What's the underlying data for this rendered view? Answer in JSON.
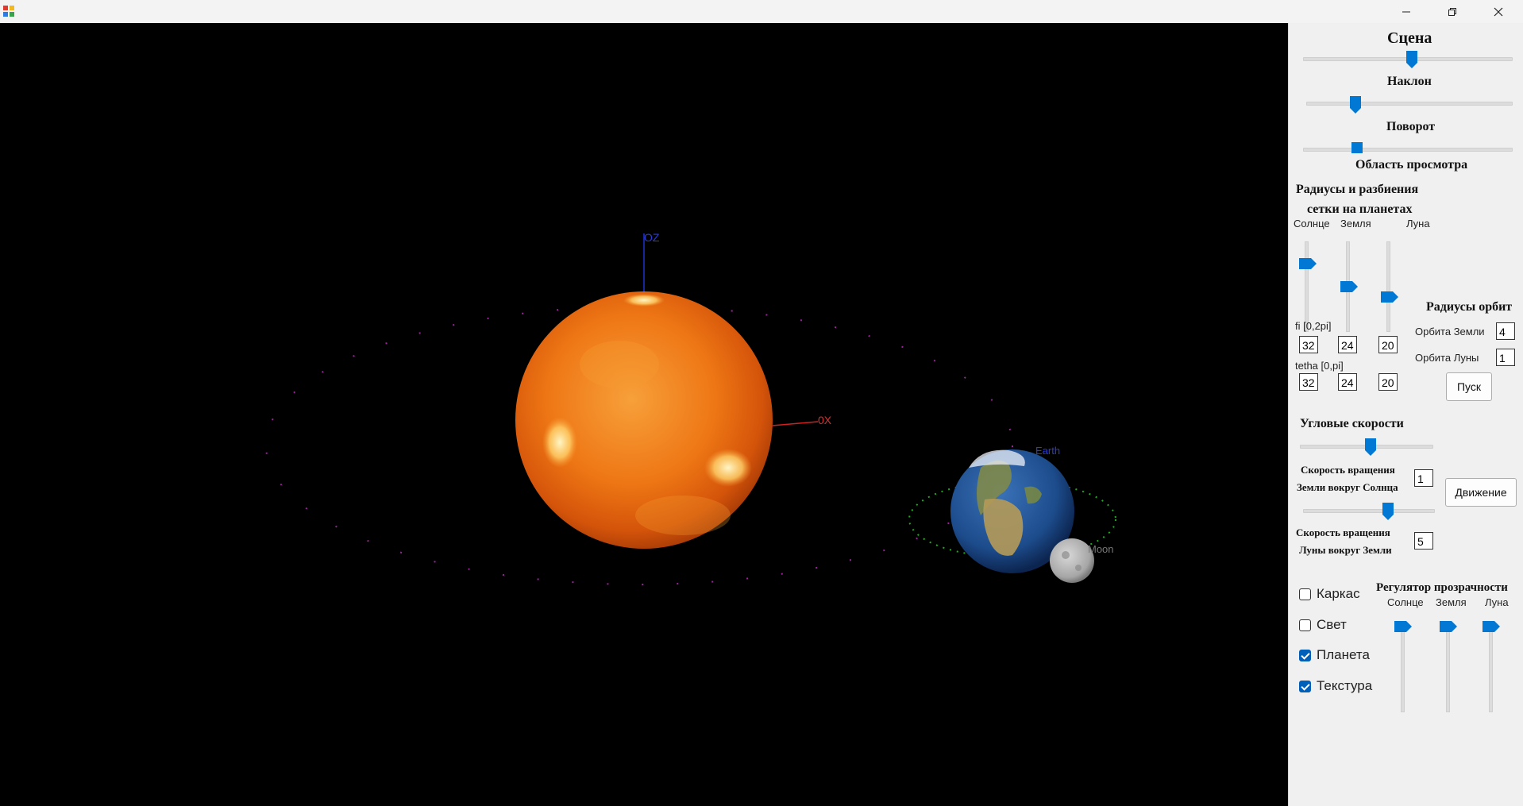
{
  "window": {
    "controls": [
      "minimize",
      "maximize",
      "close"
    ],
    "accent_color": "#0078d4"
  },
  "scene": {
    "axis_z_label": "OZ",
    "axis_x_label": "0X",
    "earth_label": "Earth",
    "moon_label": "Moon",
    "background": "#000000",
    "sun_color": "#f07a14",
    "orbit_earth_color": "#a020a0",
    "orbit_moon_color": "#22aa22"
  },
  "panel": {
    "scene_title": "Сцена",
    "tilt_title": "Наклон",
    "rotation_title": "Поворот",
    "view_area_title": "Область просмотра",
    "radius_title_line1": "Радиусы и разбиения",
    "radius_title_line2": "сетки на планетах",
    "col_sun": "Солнце",
    "col_earth": "Земля",
    "col_moon": "Луна",
    "fi_label": "fi [0,2pi]",
    "tetha_label": "tetha [0,pi]",
    "fi_values": [
      "32",
      "24",
      "20"
    ],
    "tetha_values": [
      "32",
      "24",
      "20"
    ],
    "orbit_radius_title": "Радиусы орбит",
    "earth_orbit_label": "Орбита Земли",
    "earth_orbit_value": "4",
    "moon_orbit_label": "Орбита Луны",
    "moon_orbit_value": "1",
    "start_button": "Пуск",
    "angular_speeds_title": "Угловые скорости",
    "earth_speed_line1": "Скорость вращения",
    "earth_speed_line2": "Земли вокруг Солнца",
    "earth_speed_value": "1",
    "motion_button": "Движение",
    "moon_speed_line1": "Скорость вращения",
    "moon_speed_line2": "Луны вокруг Земли",
    "moon_speed_value": "5",
    "checkboxes": [
      {
        "label": "Каркас",
        "checked": false
      },
      {
        "label": "Свет",
        "checked": false
      },
      {
        "label": "Планета",
        "checked": true
      },
      {
        "label": "Текстура",
        "checked": true
      }
    ],
    "transparency_title": "Регулятор прозрачности",
    "t_sun": "Солнце",
    "t_earth": "Земля",
    "t_moon": "Луна"
  }
}
